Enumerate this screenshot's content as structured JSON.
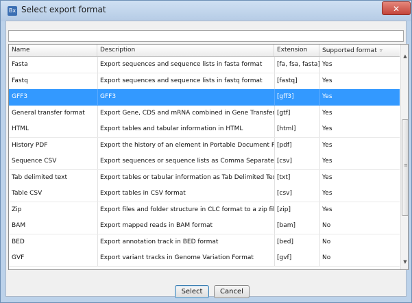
{
  "window": {
    "title": "Select export format",
    "app_icon_text": "Bx",
    "close_glyph": "✕"
  },
  "filter": {
    "value": "",
    "placeholder": ""
  },
  "table": {
    "columns": [
      "Name",
      "Description",
      "Extension",
      "Supported format"
    ],
    "sort_indicator": "▿",
    "rows": [
      {
        "name": "Fasta",
        "description": "Export sequences and sequence lists in fasta format",
        "extension": "[fa, fsa, fasta]",
        "supported": "Yes",
        "selected": false
      },
      {
        "name": "Fastq",
        "description": "Export sequences and sequence lists in fastq format",
        "extension": "[fastq]",
        "supported": "Yes",
        "selected": false
      },
      {
        "name": "GFF3",
        "description": "GFF3",
        "extension": "[gff3]",
        "supported": "Yes",
        "selected": true
      },
      {
        "name": "General transfer format",
        "description": "Export Gene, CDS and mRNA combined in Gene Transfer Format",
        "extension": "[gtf]",
        "supported": "Yes",
        "selected": false
      },
      {
        "name": "HTML",
        "description": "Export tables and tabular information in HTML",
        "extension": "[html]",
        "supported": "Yes",
        "selected": false
      },
      {
        "name": "History PDF",
        "description": "Export the history of an element in Portable Document Format",
        "extension": "[pdf]",
        "supported": "Yes",
        "selected": false
      },
      {
        "name": "Sequence CSV",
        "description": "Export sequences or sequence lists as Comma Separated Values",
        "extension": "[csv]",
        "supported": "Yes",
        "selected": false
      },
      {
        "name": "Tab delimited text",
        "description": "Export tables or tabular information as Tab Delimited Text",
        "extension": "[txt]",
        "supported": "Yes",
        "selected": false
      },
      {
        "name": "Table CSV",
        "description": "Export tables in CSV format",
        "extension": "[csv]",
        "supported": "Yes",
        "selected": false
      },
      {
        "name": "Zip",
        "description": "Export files and folder structure in CLC format to a zip file",
        "extension": "[zip]",
        "supported": "Yes",
        "selected": false
      },
      {
        "name": "BAM",
        "description": "Export mapped reads in BAM format",
        "extension": "[bam]",
        "supported": "No",
        "selected": false
      },
      {
        "name": "BED",
        "description": "Export annotation track in BED format",
        "extension": "[bed]",
        "supported": "No",
        "selected": false
      },
      {
        "name": "GVF",
        "description": "Export variant tracks in Genome Variation Format",
        "extension": "[gvf]",
        "supported": "No",
        "selected": false
      }
    ]
  },
  "scrollbar": {
    "up_glyph": "▲",
    "down_glyph": "▼",
    "grip_glyph": "≡"
  },
  "buttons": {
    "select": "Select",
    "cancel": "Cancel"
  },
  "colors": {
    "selection": "#3399ff",
    "titlebar": "#bcd2ea",
    "close": "#c4443a"
  }
}
